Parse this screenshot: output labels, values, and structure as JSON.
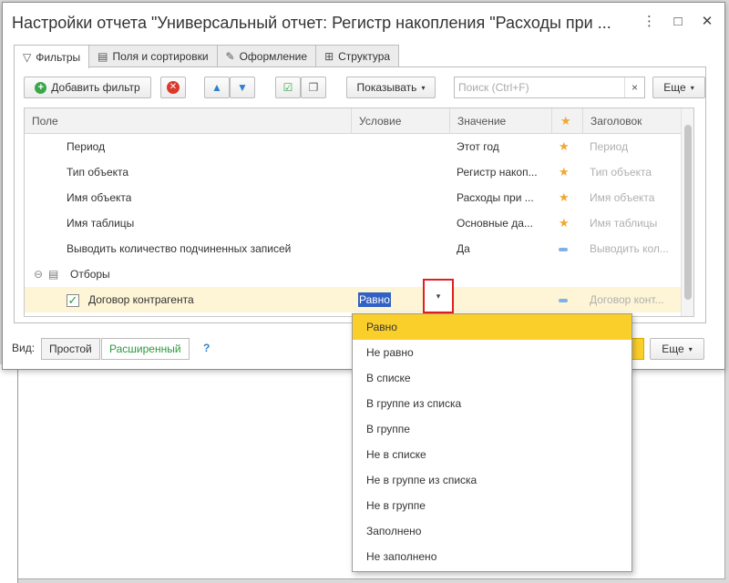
{
  "window": {
    "title": "Настройки отчета \"Универсальный отчет: Регистр накопления \"Расходы при ...",
    "menu_icon": "⋮",
    "restore_icon": "□",
    "close_icon": "✕"
  },
  "tabs": [
    {
      "label": "Фильтры",
      "icon": "filter-icon",
      "glyph": "▽"
    },
    {
      "label": "Поля и сортировки",
      "icon": "fields-icon",
      "glyph": "▤"
    },
    {
      "label": "Оформление",
      "icon": "brush-icon",
      "glyph": "✎"
    },
    {
      "label": "Структура",
      "icon": "structure-icon",
      "glyph": "⊞"
    }
  ],
  "toolbar": {
    "add_filter": "Добавить фильтр",
    "add_glyph": "+",
    "delete_glyph": "✕",
    "up_glyph": "▲",
    "down_glyph": "▼",
    "check_glyph": "☑",
    "copy_glyph": "❐",
    "show": "Показывать",
    "search_placeholder": "Поиск (Ctrl+F)",
    "clear_glyph": "×",
    "more": "Еще"
  },
  "grid": {
    "columns": [
      "Поле",
      "Условие",
      "Значение",
      "★",
      "Заголовок"
    ],
    "rows": [
      {
        "field": "Период",
        "condition": "",
        "value": "Этот год",
        "mark": "star",
        "title": "Период"
      },
      {
        "field": "Тип объекта",
        "condition": "",
        "value": "Регистр накоп...",
        "mark": "star",
        "title": "Тип объекта"
      },
      {
        "field": "Имя объекта",
        "condition": "",
        "value": "Расходы при ...",
        "mark": "star",
        "title": "Имя объекта"
      },
      {
        "field": "Имя таблицы",
        "condition": "",
        "value": "Основные да...",
        "mark": "star",
        "title": "Имя таблицы"
      },
      {
        "field": "Выводить количество подчиненных записей",
        "condition": "",
        "value": "Да",
        "mark": "dash",
        "title": "Выводить кол..."
      }
    ],
    "group": {
      "label": "Отборы",
      "toggle": "⊖",
      "icon": "▤"
    },
    "filter_row": {
      "field": "Договор контрагента",
      "condition": "Равно",
      "checked": true,
      "check_glyph": "✓",
      "title": "Договор конт..."
    },
    "dropdown_glyph": "▾",
    "star_glyph": "★"
  },
  "footer": {
    "view_label": "Вид:",
    "simple": "Простой",
    "extended": "Расширенный",
    "help": "?",
    "more": "Еще"
  },
  "dropdown": {
    "items": [
      "Равно",
      "Не равно",
      "В списке",
      "В группе из списка",
      "В группе",
      "Не в списке",
      "Не в группе из списка",
      "Не в группе",
      "Заполнено",
      "Не заполнено"
    ],
    "selected_index": 0
  },
  "colors": {
    "accent_yellow": "#fbcf2a",
    "selection_blue": "#3261c4",
    "highlight_red": "#e02020",
    "star_orange": "#f0a830"
  }
}
